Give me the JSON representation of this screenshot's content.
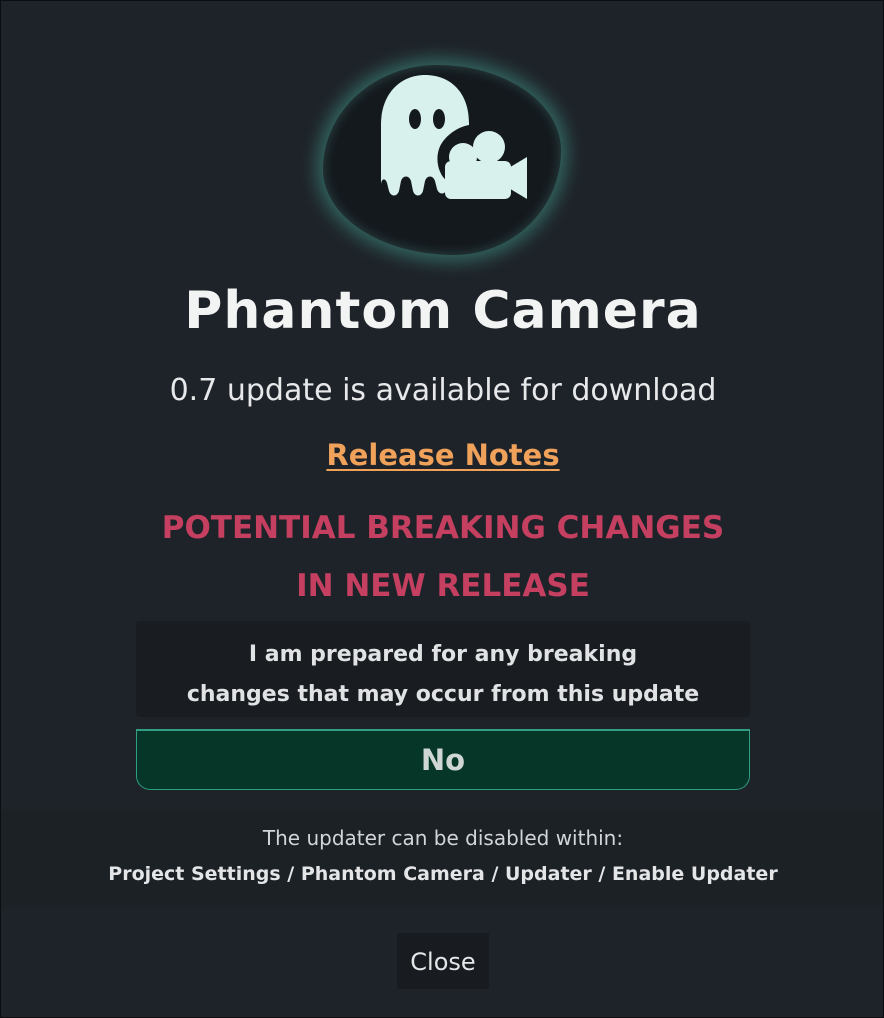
{
  "dialog": {
    "logo_icon": "phantom-camera-ghost-icon",
    "title": "Phantom Camera",
    "subtitle": "0.7 update is available for download",
    "release_notes_label": "Release Notes",
    "warning_line1": "POTENTIAL BREAKING CHANGES",
    "warning_line2": "IN NEW RELEASE",
    "confirm_line1": "I am prepared for any breaking",
    "confirm_line2": "changes that may occur from this update",
    "no_label": "No",
    "footer_line1": "The updater can be disabled within:",
    "footer_line2": "Project Settings / Phantom Camera / Updater / Enable Updater",
    "close_label": "Close"
  },
  "colors": {
    "background": "#1e2329",
    "title": "#f2f3f3",
    "link": "#f0a15a",
    "warning": "#c43f60",
    "button_fill": "#053628",
    "button_border": "#2f9e83",
    "logo_glow": "#50beaa"
  }
}
